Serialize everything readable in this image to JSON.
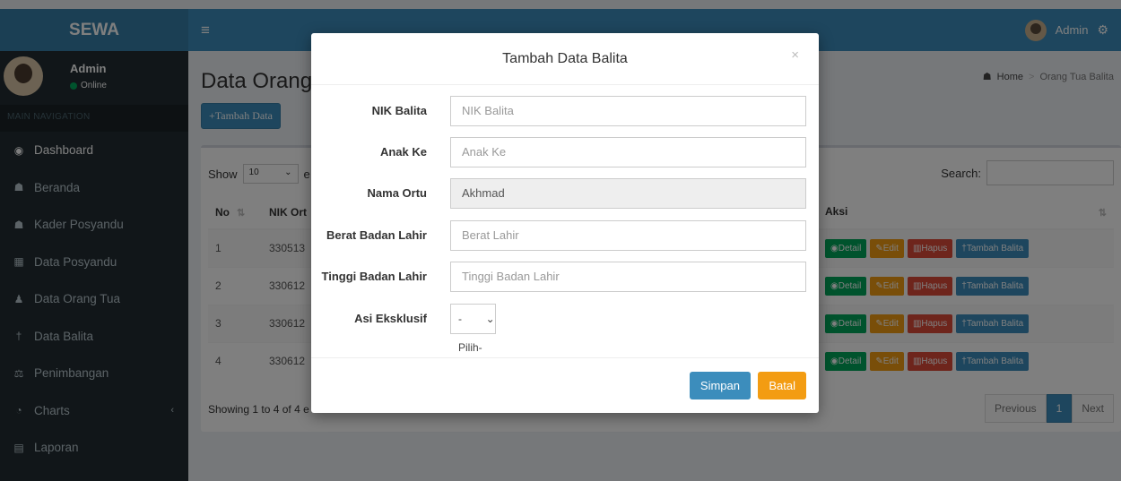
{
  "header": {
    "logo": "SEWA",
    "menu_icon": "hamburger-icon",
    "user_name": "Admin",
    "settings_icon": "gear-icon"
  },
  "sidebar": {
    "user": {
      "name": "Admin",
      "status": "Online"
    },
    "section_label": "MAIN NAVIGATION",
    "items": [
      {
        "label": "Dashboard",
        "icon": "dashboard-icon"
      },
      {
        "label": "Beranda",
        "icon": "users-icon"
      },
      {
        "label": "Kader Posyandu",
        "icon": "users-icon"
      },
      {
        "label": "Data Posyandu",
        "icon": "building-icon"
      },
      {
        "label": "Data Orang Tua",
        "icon": "user-icon"
      },
      {
        "label": "Data Balita",
        "icon": "child-icon"
      },
      {
        "label": "Penimbangan",
        "icon": "scale-icon"
      },
      {
        "label": "Charts",
        "icon": "pie-chart-icon"
      },
      {
        "label": "Laporan",
        "icon": "book-icon"
      }
    ]
  },
  "page": {
    "title": "Data Orang T",
    "add_button": "+Tambah Data",
    "breadcrumb": {
      "home": "Home",
      "current": "Orang Tua Balita"
    }
  },
  "table_controls": {
    "show_label": "Show",
    "entries_value": "10",
    "entries_suffix": "e",
    "search_label": "Search:"
  },
  "table": {
    "headers": {
      "no": "No",
      "nik": "NIK Ort",
      "aksi": "Aksi"
    },
    "rows": [
      {
        "no": "1",
        "nik": "330513"
      },
      {
        "no": "2",
        "nik": "330612"
      },
      {
        "no": "3",
        "nik": "330612"
      },
      {
        "no": "4",
        "nik": "330612"
      }
    ],
    "actions": {
      "detail": "Detail",
      "edit": "Edit",
      "hapus": "Hapus",
      "tambah": "Tambah Balita"
    }
  },
  "footer": {
    "showing": "Showing 1 to 4 of 4 e",
    "prev": "Previous",
    "page": "1",
    "next": "Next"
  },
  "modal": {
    "title": "Tambah Data Balita",
    "close": "×",
    "fields": [
      {
        "label": "NIK Balita",
        "placeholder": "NIK Balita",
        "value": ""
      },
      {
        "label": "Anak Ke",
        "placeholder": "Anak Ke",
        "value": ""
      },
      {
        "label": "Nama Ortu",
        "placeholder": "",
        "value": "Akhmad"
      },
      {
        "label": "Berat Badan Lahir",
        "placeholder": "Berat Lahir",
        "value": ""
      },
      {
        "label": "Tinggi Badan Lahir",
        "placeholder": "Tinggi Badan Lahir",
        "value": ""
      }
    ],
    "select": {
      "label": "Asi Eksklusif",
      "value": "-Pilih-"
    },
    "buttons": {
      "save": "Simpan",
      "cancel": "Batal"
    }
  },
  "colors": {
    "primary": "#3c8dbc",
    "success": "#00a65a",
    "warning": "#f39c12",
    "danger": "#dd4b39",
    "sidebar": "#222d32"
  }
}
